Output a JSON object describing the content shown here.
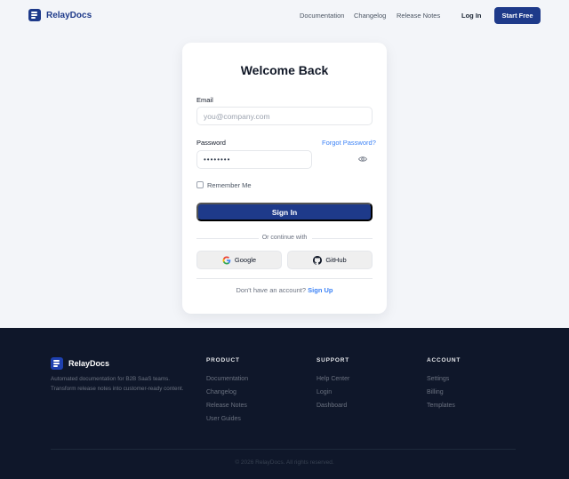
{
  "header": {
    "brand": "RelayDocs",
    "nav": [
      "Documentation",
      "Changelog",
      "Release Notes"
    ],
    "login_label": "Log In",
    "cta_label": "Start Free"
  },
  "card": {
    "title": "Welcome Back",
    "email_label": "Email",
    "email_placeholder": "you@company.com",
    "password_label": "Password",
    "forgot_label": "Forgot Password?",
    "password_value": "••••••••",
    "remember_label": "Remember Me",
    "signin_label": "Sign In",
    "divider_text": "Or continue with",
    "google_label": "Google",
    "github_label": "GitHub",
    "no_account_text": "Don't have an account?",
    "signup_label": "Sign Up"
  },
  "footer": {
    "brand": "RelayDocs",
    "description": "Automated documentation for B2B SaaS teams. Transform release notes into customer-ready content.",
    "columns": [
      {
        "heading": "PRODUCT",
        "links": [
          "Documentation",
          "Changelog",
          "Release Notes",
          "User Guides"
        ]
      },
      {
        "heading": "SUPPORT",
        "links": [
          "Help Center",
          "Login",
          "Dashboard"
        ]
      },
      {
        "heading": "ACCOUNT",
        "links": [
          "Settings",
          "Billing",
          "Templates"
        ]
      }
    ],
    "copyright": "© 2026 RelayDocs. All rights reserved."
  },
  "colors": {
    "primary": "#1e3a8a",
    "link": "#3b82f6",
    "footer_bg": "#0f172a",
    "page_bg": "#f3f5f9"
  },
  "icons": [
    "logo-icon",
    "eye-icon",
    "google-icon",
    "github-icon"
  ]
}
